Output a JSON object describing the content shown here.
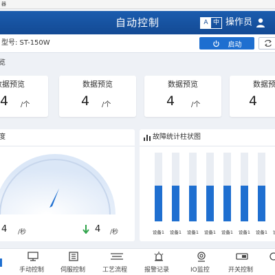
{
  "status_bar": {
    "text": "器"
  },
  "header": {
    "title": "自动控制",
    "lang_a": "A",
    "lang_b": "中",
    "operator": "操作员"
  },
  "toolbar": {
    "model_label": "型号: ST-150W",
    "start_label": "启动"
  },
  "overview": {
    "title": "总览",
    "cards": [
      {
        "title": "数据预览",
        "value": "4",
        "unit": "/个"
      },
      {
        "title": "数据预览",
        "value": "4",
        "unit": "/个"
      },
      {
        "title": "数据预览",
        "value": "4",
        "unit": "/个"
      },
      {
        "title": "数据预览",
        "value": "4",
        "unit": ""
      }
    ]
  },
  "speed_panel": {
    "title": "速度",
    "left_value": "4",
    "left_unit": "/秒",
    "right_value": "4",
    "right_unit": "/秒"
  },
  "fault_chart": {
    "title": "故障统计柱状图",
    "categories": [
      "设备1",
      "设备1",
      "设备1",
      "设备1",
      "设备1",
      "设备1",
      "设备1",
      "设备1"
    ],
    "track_color": "#e9edf3",
    "bar_color": "#1f6fd0"
  },
  "bottom_nav": {
    "items": [
      {
        "label": "手动控制",
        "icon": "monitor-icon"
      },
      {
        "label": "伺服控制",
        "icon": "servo-icon"
      },
      {
        "label": "工艺流程",
        "icon": "process-icon"
      },
      {
        "label": "报警记录",
        "icon": "alarm-icon"
      },
      {
        "label": "IO监控",
        "icon": "io-icon"
      },
      {
        "label": "开关控制",
        "icon": "switch-icon"
      }
    ]
  }
}
